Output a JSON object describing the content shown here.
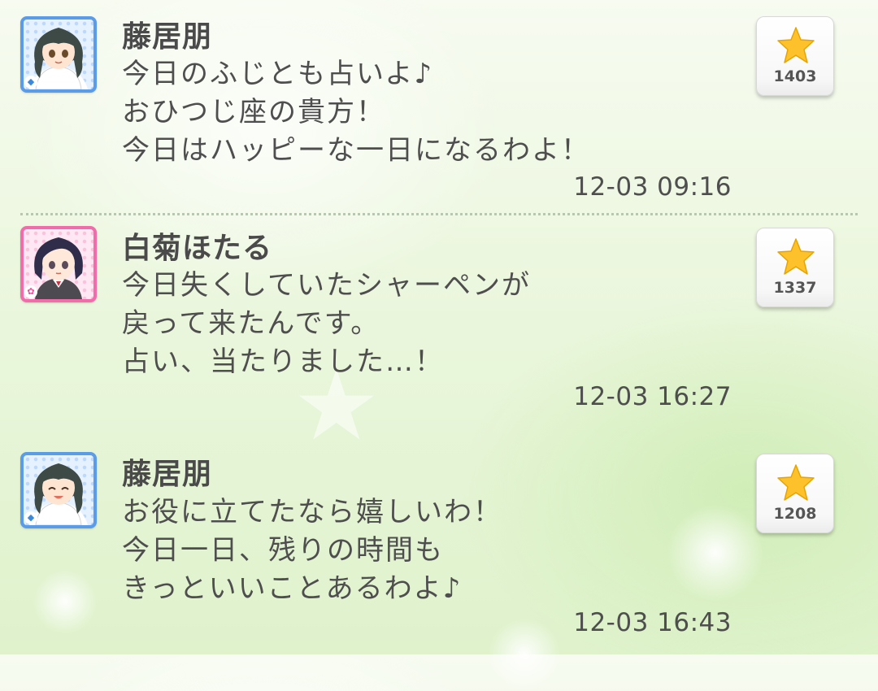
{
  "posts": [
    {
      "author": "藤居朋",
      "avatar_type": "cool",
      "avatar_badge_icon": "diamond-icon",
      "avatar_color": "#5a9ce8",
      "message_lines": [
        "今日のふじとも占いよ♪",
        "おひつじ座の貴方！",
        "今日はハッピーな一日になるわよ！"
      ],
      "timestamp": "12-03 09:16",
      "like_icon": "star-icon",
      "like_count": "1403"
    },
    {
      "author": "白菊ほたる",
      "avatar_type": "cute",
      "avatar_badge_icon": "flower-icon",
      "avatar_color": "#f06cab",
      "message_lines": [
        "今日失くしていたシャーペンが",
        "戻って来たんです。",
        "占い、当たりました…！"
      ],
      "timestamp": "12-03 16:27",
      "like_icon": "star-icon",
      "like_count": "1337"
    },
    {
      "author": "藤居朋",
      "avatar_type": "cool",
      "avatar_badge_icon": "diamond-icon",
      "avatar_color": "#5a9ce8",
      "message_lines": [
        "お役に立てたなら嬉しいわ！",
        "今日一日、残りの時間も",
        "きっといいことあるわよ♪"
      ],
      "timestamp": "12-03 16:43",
      "like_icon": "star-icon",
      "like_count": "1208"
    }
  ],
  "colors": {
    "star": "#fdc22b",
    "star_stroke": "#e7a400",
    "text": "#4a4a4a",
    "divider": "#b9c7b2"
  }
}
